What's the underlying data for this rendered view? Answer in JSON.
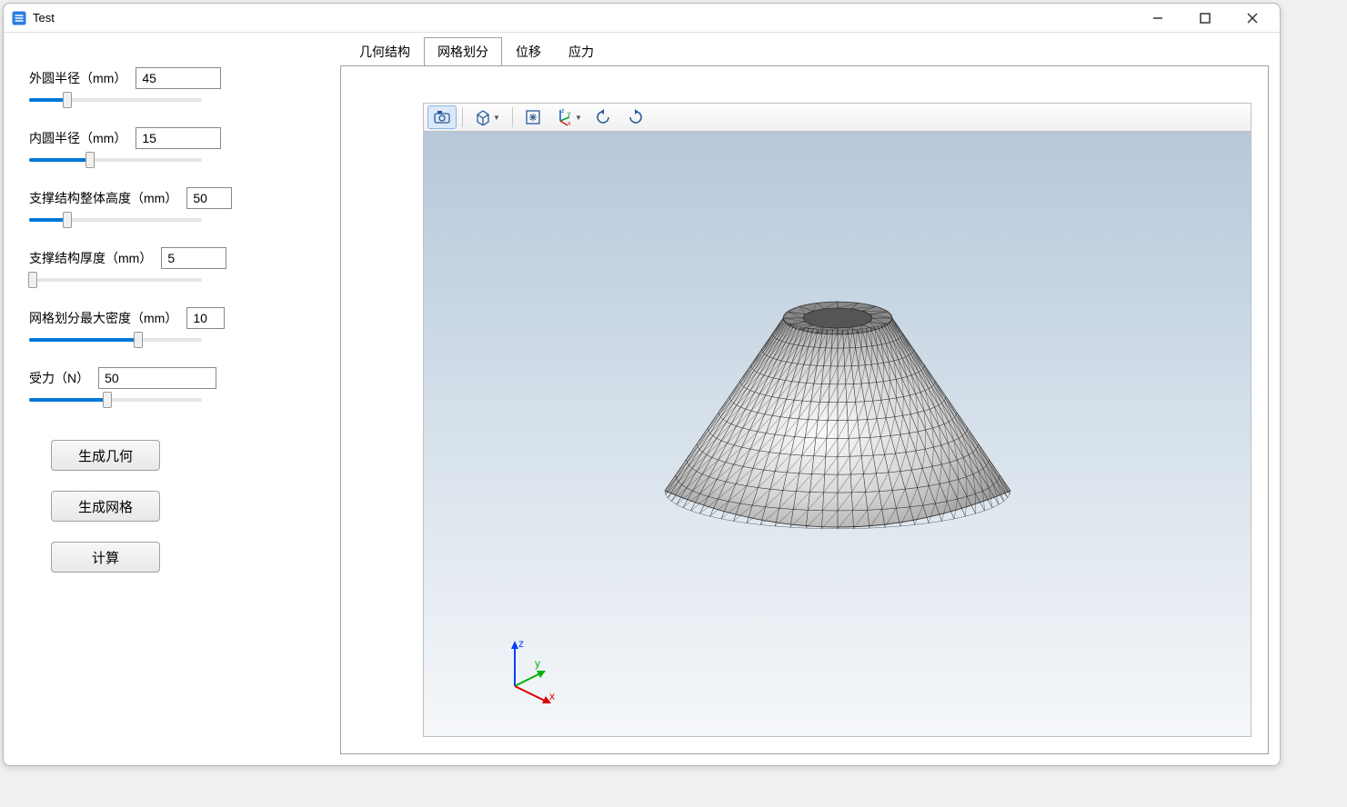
{
  "window": {
    "title": "Test"
  },
  "params": {
    "outer_radius": {
      "label": "外圆半径（mm）",
      "value": "45",
      "slider_pct": 22
    },
    "inner_radius": {
      "label": "内圆半径（mm）",
      "value": "15",
      "slider_pct": 35
    },
    "height": {
      "label": "支撑结构整体高度（mm）",
      "value": "50",
      "slider_pct": 22
    },
    "thickness": {
      "label": "支撑结构厚度（mm）",
      "value": "5",
      "slider_pct": 2
    },
    "mesh_density": {
      "label": "网格划分最大密度（mm）",
      "value": "10",
      "slider_pct": 63
    },
    "force": {
      "label": "受力（N）",
      "value": "50",
      "slider_pct": 45
    }
  },
  "buttons": {
    "gen_geometry": "生成几何",
    "gen_mesh": "生成网格",
    "compute": "计算"
  },
  "tabs": {
    "geometry": "几何结构",
    "mesh": "网格划分",
    "displacement": "位移",
    "stress": "应力",
    "active": "mesh"
  },
  "toolbar": {
    "icons": {
      "camera": "camera-icon",
      "cube_view": "cube-view-icon",
      "fit": "fit-view-icon",
      "axes": "axes-icon",
      "rotate_left": "rotate-left-icon",
      "rotate_right": "rotate-right-icon"
    }
  },
  "axes": {
    "x": "x",
    "y": "y",
    "z": "z"
  }
}
